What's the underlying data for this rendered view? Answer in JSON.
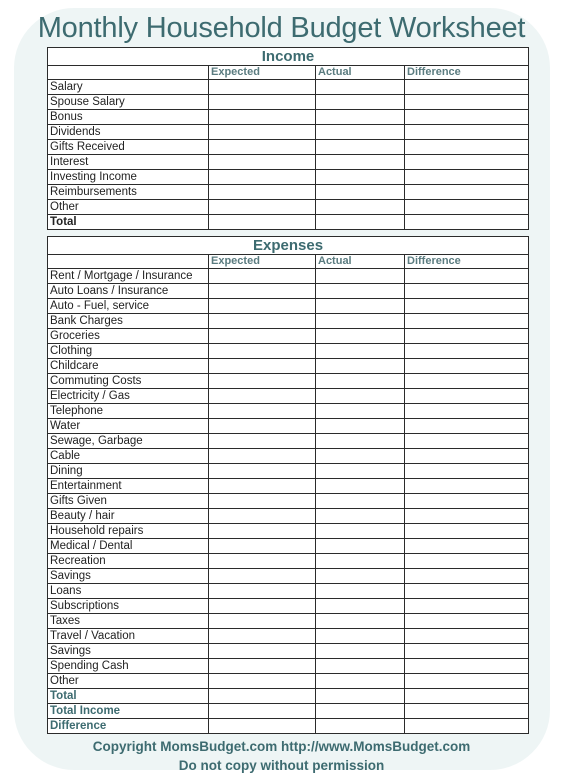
{
  "title": "Monthly Household Budget Worksheet",
  "columns": [
    "",
    "Expected",
    "Actual",
    "Difference"
  ],
  "income": {
    "heading": "Income",
    "rows": [
      "Salary",
      "Spouse Salary",
      "Bonus",
      "Dividends",
      "Gifts Received",
      "Interest",
      "Investing Income",
      "Reimbursements",
      "Other"
    ],
    "total": "Total"
  },
  "expenses": {
    "heading": "Expenses",
    "rows": [
      "Rent / Mortgage / Insurance",
      "Auto Loans / Insurance",
      "Auto - Fuel, service",
      "Bank Charges",
      "Groceries",
      "Clothing",
      "Childcare",
      "Commuting Costs",
      "Electricity / Gas",
      "Telephone",
      "Water",
      "Sewage, Garbage",
      "Cable",
      "Dining",
      "Entertainment",
      "Gifts Given",
      "Beauty / hair",
      "Household repairs",
      "Medical / Dental",
      "Recreation",
      "Savings",
      "Loans",
      "Subscriptions",
      "Taxes",
      "Travel / Vacation",
      "Savings",
      "Spending Cash",
      "Other"
    ],
    "summary": [
      "Total",
      "Total Income",
      "Difference"
    ]
  },
  "footer": {
    "line1": "Copyright MomsBudget.com  http://www.MomsBudget.com",
    "line2": "Do not copy without permission"
  },
  "colors": {
    "accent": "#3d6b70",
    "background": "#eef5f5"
  }
}
